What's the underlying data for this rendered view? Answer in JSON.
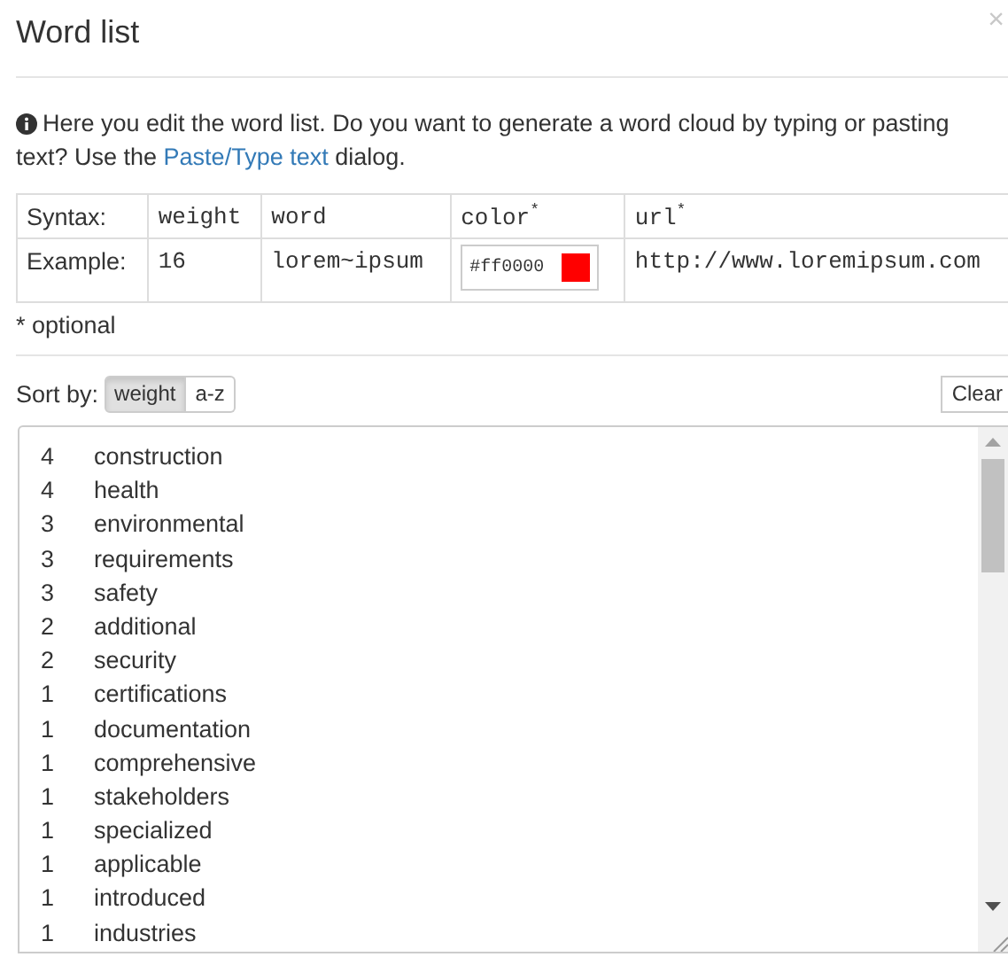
{
  "dialog": {
    "title": "Word list",
    "close": "×"
  },
  "info": {
    "text": "Here you edit the word list. Do you want to generate a word cloud by typing or pasting text? Use the ",
    "link": "Paste/Type text",
    "after": " dialog."
  },
  "syntax_table": {
    "header": [
      "Syntax:",
      "weight",
      "word",
      "color$^{*}$",
      "url$^{*}$"
    ],
    "example": {
      "label": "Example:",
      "weight": "16",
      "word": "lorem~ipsum",
      "color": {
        "text": "#ff0000",
        "color": "#ff0000"
      },
      "url": "http://www.loremipsum.com"
    }
  },
  "note": "* optional",
  "sort": {
    "label": "Sort by:",
    "options": [
      {
        "label": "weight",
        "selected": true
      },
      {
        "label": "a-z",
        "selected": false
      }
    ]
  },
  "clear_button": "Clear",
  "words": [
    {
      "weight": "4",
      "word": "construction"
    },
    {
      "weight": "4",
      "word": "health"
    },
    {
      "weight": "3",
      "word": "environmental"
    },
    {
      "weight": "3",
      "word": "requirements"
    },
    {
      "weight": "3",
      "word": "safety"
    },
    {
      "weight": "2",
      "word": "additional"
    },
    {
      "weight": "2",
      "word": "security"
    },
    {
      "weight": "1",
      "word": "certifications"
    },
    {
      "weight": "1",
      "word": "documentation"
    },
    {
      "weight": "1",
      "word": "comprehensive"
    },
    {
      "weight": "1",
      "word": "stakeholders"
    },
    {
      "weight": "1",
      "word": "specialized"
    },
    {
      "weight": "1",
      "word": "applicable"
    },
    {
      "weight": "1",
      "word": "introduced"
    },
    {
      "weight": "1",
      "word": "industries"
    }
  ]
}
